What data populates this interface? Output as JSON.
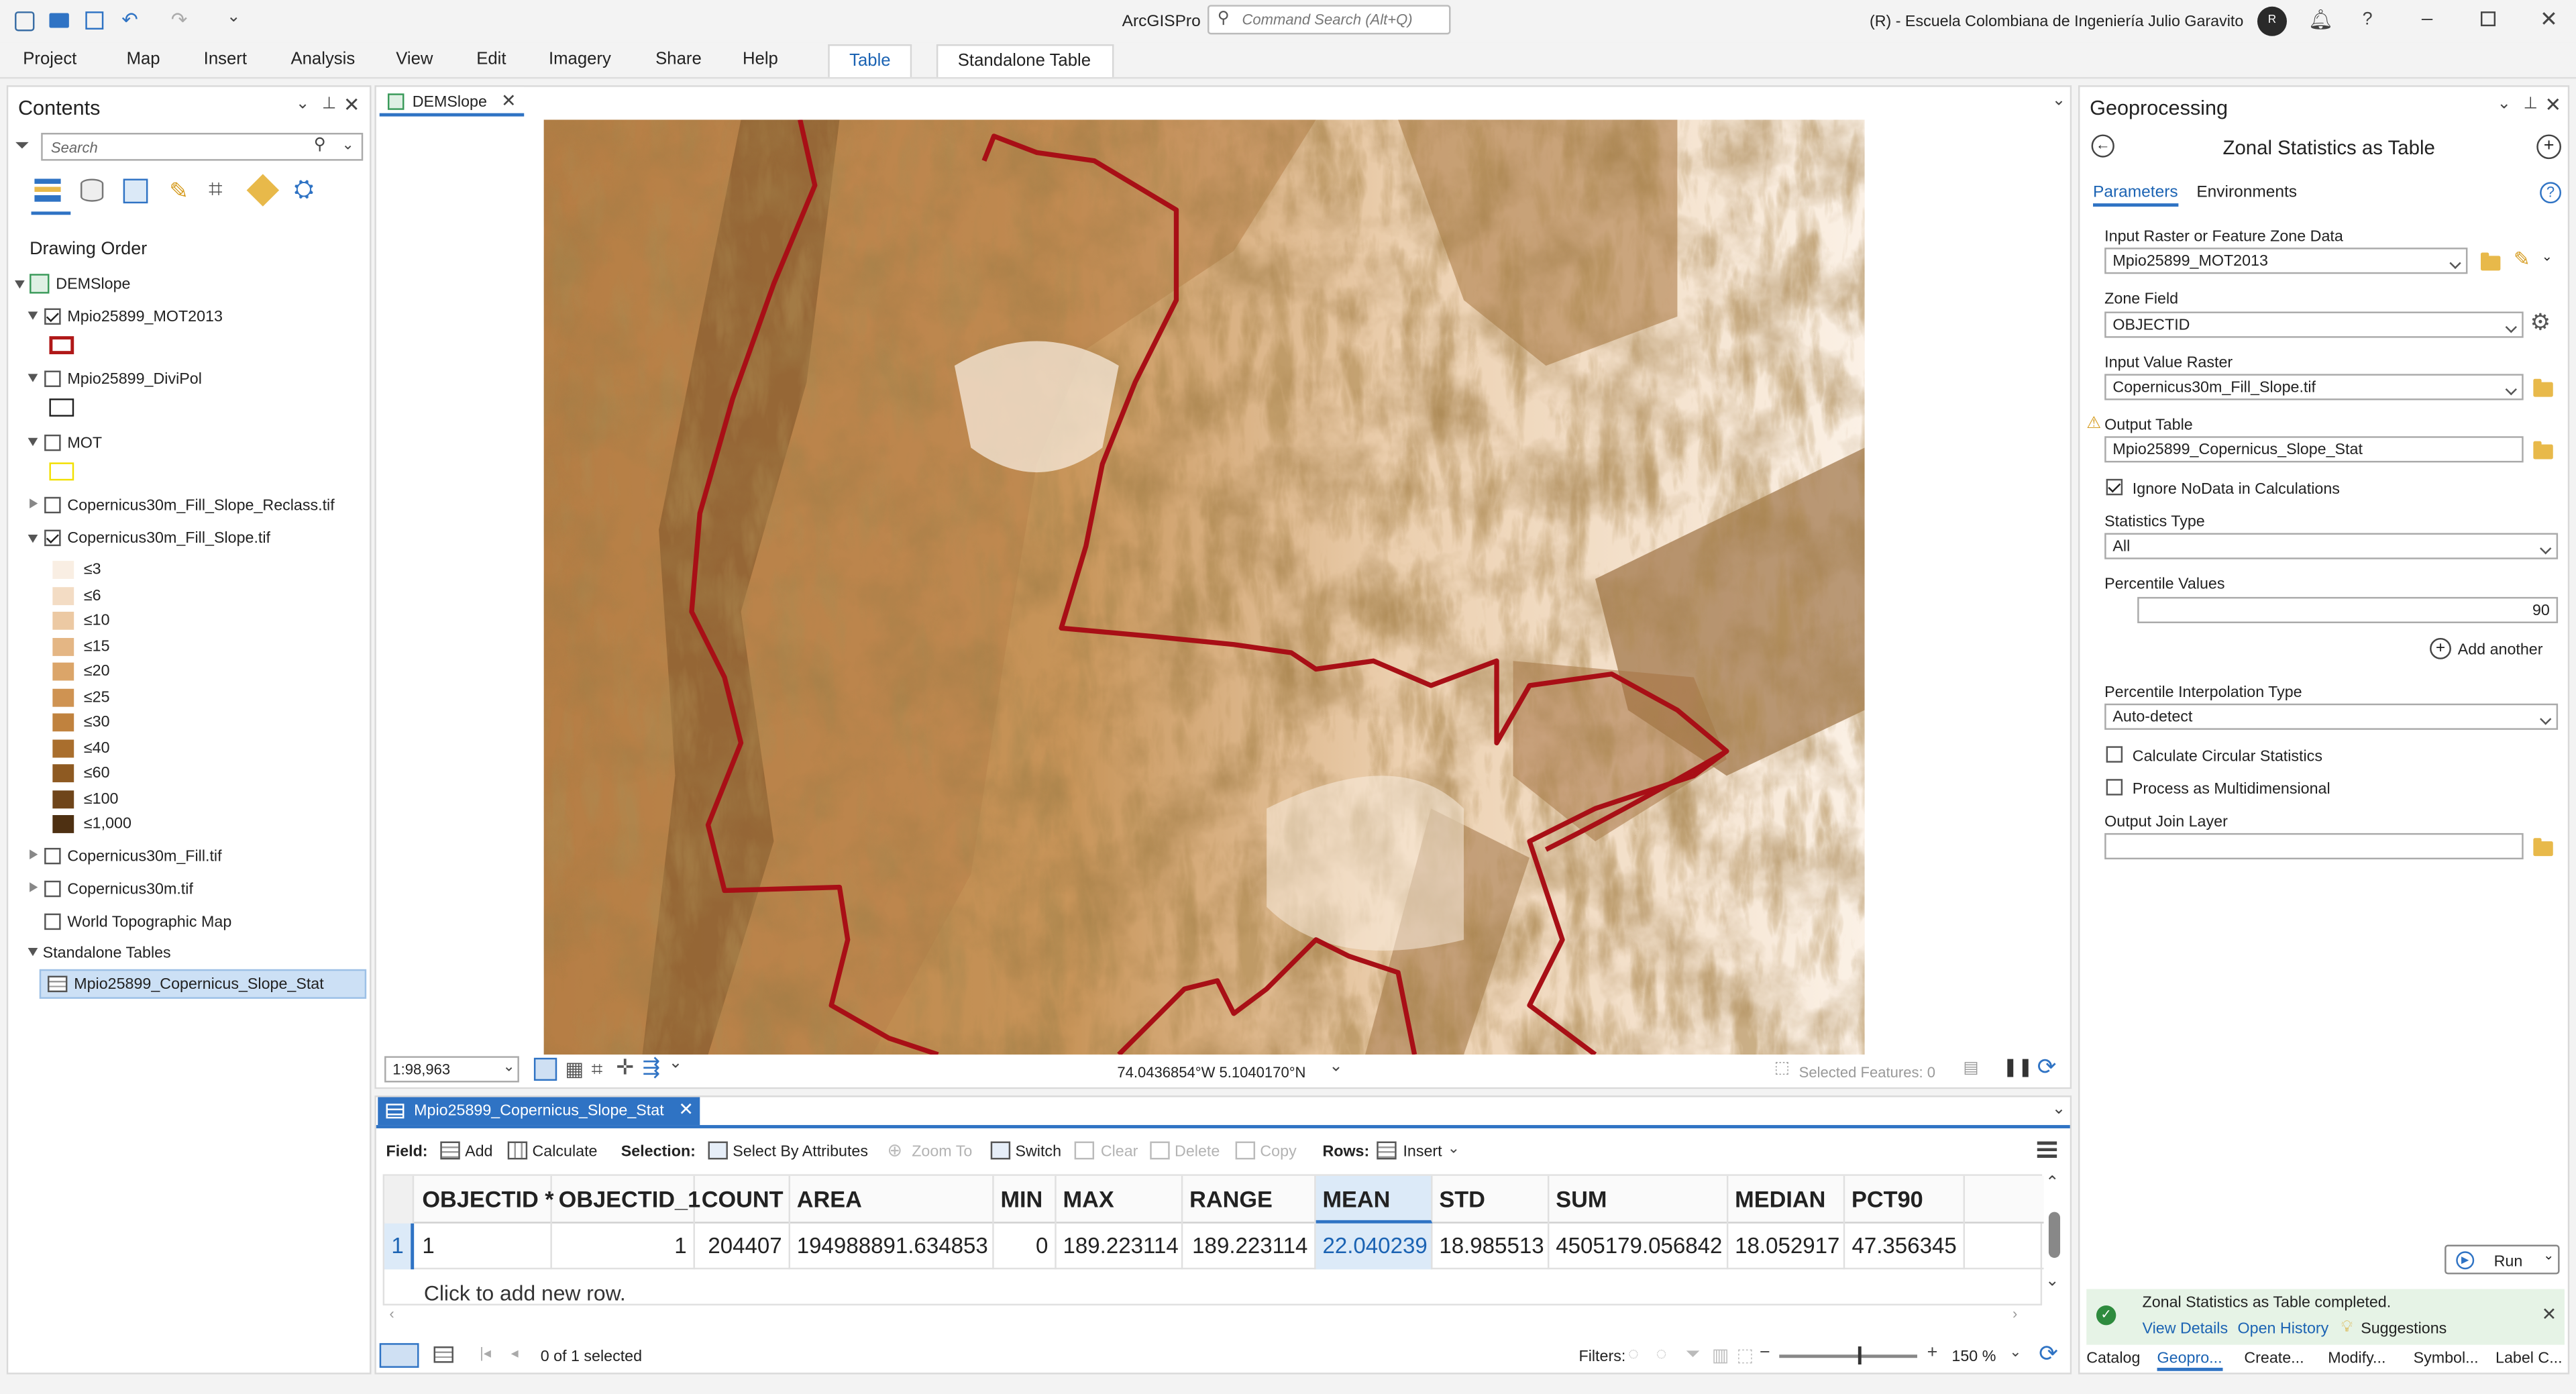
{
  "app": {
    "title": "ArcGISPro",
    "search_placeholder": "Command Search (Alt+Q)",
    "org": "(R) - Escuela Colombiana de Ingeniería Julio Garavito",
    "avatar": "R"
  },
  "ribbon": {
    "tabs": [
      "Project",
      "Map",
      "Insert",
      "Analysis",
      "View",
      "Edit",
      "Imagery",
      "Share",
      "Help"
    ],
    "context_tabs": [
      "Table",
      "Standalone Table"
    ]
  },
  "contents": {
    "title": "Contents",
    "search_placeholder": "Search",
    "drawing_order": "Drawing Order",
    "map_name": "DEMSlope",
    "layers": [
      "Mpio25899_MOT2013",
      "Mpio25899_DiviPol",
      "MOT",
      "Copernicus30m_Fill_Slope_Reclass.tif",
      "Copernicus30m_Fill_Slope.tif",
      "Copernicus30m_Fill.tif",
      "Copernicus30m.tif",
      "World Topographic Map"
    ],
    "legend": [
      {
        "label": "≤3",
        "color": "#f9eee3"
      },
      {
        "label": "≤6",
        "color": "#f3dcc4"
      },
      {
        "label": "≤10",
        "color": "#ecc9a3"
      },
      {
        "label": "≤15",
        "color": "#e4b684"
      },
      {
        "label": "≤20",
        "color": "#dba569"
      },
      {
        "label": "≤25",
        "color": "#cf9352"
      },
      {
        "label": "≤30",
        "color": "#c0823e"
      },
      {
        "label": "≤40",
        "color": "#a96e2d"
      },
      {
        "label": "≤60",
        "color": "#8e5a22"
      },
      {
        "label": "≤100",
        "color": "#6f451a"
      },
      {
        "label": "≤1,000",
        "color": "#4e3012"
      }
    ],
    "standalone_tables": "Standalone Tables",
    "table_item": "Mpio25899_Copernicus_Slope_Stat"
  },
  "map": {
    "tab": "DEMSlope",
    "scale": "1:98,963",
    "coords": "74.0436854°W 5.1040170°N",
    "selected": "Selected Features: 0"
  },
  "table": {
    "tab": "Mpio25899_Copernicus_Slope_Stat",
    "toolbar": {
      "field": "Field:",
      "add": "Add",
      "calculate": "Calculate",
      "selection": "Selection:",
      "select_by_attr": "Select By Attributes",
      "zoom_to": "Zoom To",
      "switch": "Switch",
      "clear": "Clear",
      "delete": "Delete",
      "copy": "Copy",
      "rows": "Rows:",
      "insert": "Insert"
    },
    "columns": [
      "OBJECTID *",
      "OBJECTID_1",
      "COUNT",
      "AREA",
      "MIN",
      "MAX",
      "RANGE",
      "MEAN",
      "STD",
      "SUM",
      "MEDIAN",
      "PCT90"
    ],
    "row": {
      "num": "1",
      "values": [
        "1",
        "1",
        "204407",
        "194988891.634853",
        "0",
        "189.223114",
        "189.223114",
        "22.040239",
        "18.985513",
        "4505179.056842",
        "18.052917",
        "47.356345"
      ]
    },
    "add_row": "Click to add new row.",
    "status": "0 of 1 selected",
    "filters": "Filters:",
    "zoom": "150 %"
  },
  "geo": {
    "title": "Geoprocessing",
    "tool": "Zonal Statistics as Table",
    "tab_params": "Parameters",
    "tab_env": "Environments",
    "input_zone_label": "Input Raster or Feature Zone Data",
    "input_zone": "Mpio25899_MOT2013",
    "zone_field_label": "Zone Field",
    "zone_field": "OBJECTID",
    "value_raster_label": "Input Value Raster",
    "value_raster": "Copernicus30m_Fill_Slope.tif",
    "output_label": "Output Table",
    "output": "Mpio25899_Copernicus_Slope_Stat",
    "ignore_nodata": "Ignore NoData in Calculations",
    "stats_type_label": "Statistics Type",
    "stats_type": "All",
    "percentile_label": "Percentile Values",
    "percentile": "90",
    "add_another": "Add another",
    "interp_label": "Percentile Interpolation Type",
    "interp": "Auto-detect",
    "circular": "Calculate Circular Statistics",
    "multidim": "Process as Multidimensional",
    "join_label": "Output Join Layer",
    "run": "Run",
    "done": "Zonal Statistics as Table completed.",
    "view_details": "View Details",
    "open_history": "Open History",
    "suggestions": "Suggestions"
  },
  "bottom_tabs": [
    "Catalog",
    "Geopro...",
    "Create...",
    "Modify...",
    "Symbol...",
    "Label C..."
  ]
}
